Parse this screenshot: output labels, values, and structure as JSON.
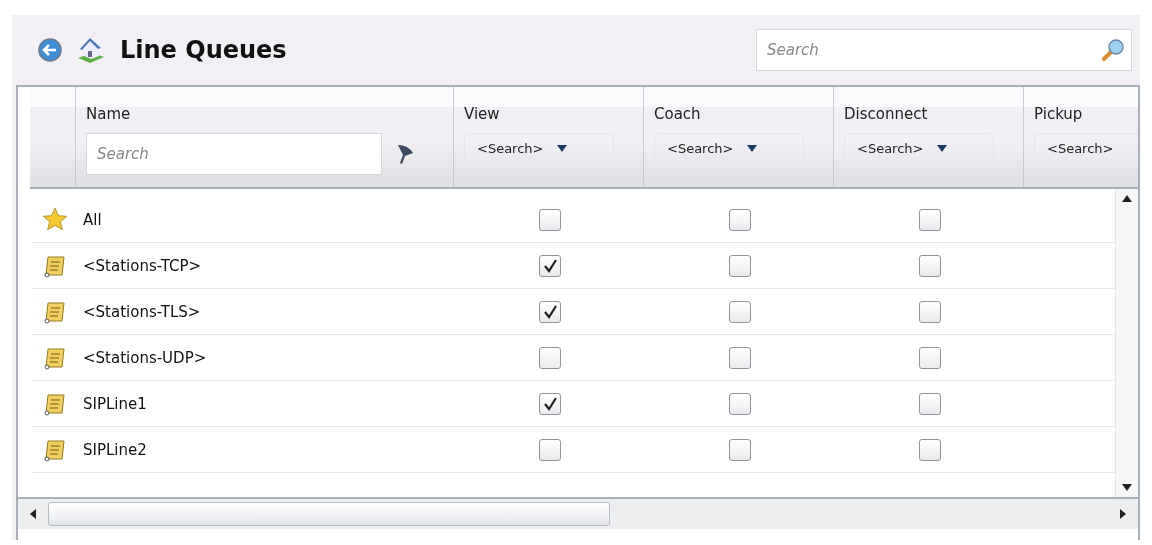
{
  "header": {
    "title": "Line Queues",
    "search": {
      "placeholder": "Search"
    }
  },
  "columns": [
    {
      "label": "Name",
      "filter": {
        "kind": "text",
        "placeholder": "Search"
      }
    },
    {
      "label": "View",
      "filter": {
        "kind": "dropdown",
        "value": "<Search>",
        "caret": true
      }
    },
    {
      "label": "Coach",
      "filter": {
        "kind": "dropdown",
        "value": "<Search>",
        "caret": true
      }
    },
    {
      "label": "Disconnect",
      "filter": {
        "kind": "dropdown",
        "value": "<Search>",
        "caret": true
      }
    },
    {
      "label": "Pickup",
      "filter": {
        "kind": "dropdown",
        "value": "<Search>",
        "caret": false
      }
    }
  ],
  "rows": [
    {
      "kind": "all",
      "name": "All",
      "view": false,
      "coach": false,
      "disconnect": false
    },
    {
      "kind": "line",
      "name": "<Stations-TCP>",
      "view": true,
      "coach": false,
      "disconnect": false
    },
    {
      "kind": "line",
      "name": "<Stations-TLS>",
      "view": true,
      "coach": false,
      "disconnect": false
    },
    {
      "kind": "line",
      "name": "<Stations-UDP>",
      "view": false,
      "coach": false,
      "disconnect": false
    },
    {
      "kind": "line",
      "name": "SIPLine1",
      "view": true,
      "coach": false,
      "disconnect": false
    },
    {
      "kind": "line",
      "name": "SIPLine2",
      "view": false,
      "coach": false,
      "disconnect": false
    }
  ]
}
